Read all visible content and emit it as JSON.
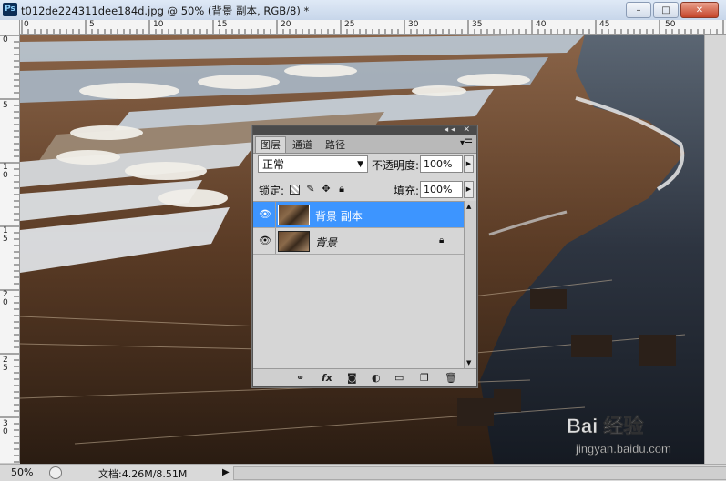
{
  "window": {
    "app_icon": "Ps",
    "title": "t012de224311dee184d.jpg @ 50% (背景 副本, RGB/8) *",
    "minimize_label": "–",
    "maximize_label": "□",
    "close_label": "✕"
  },
  "ruler": {
    "top_labels": [
      "0",
      "5",
      "10",
      "15",
      "20",
      "25",
      "30",
      "35",
      "40",
      "45",
      "50"
    ],
    "left_labels": [
      "0",
      "5",
      "1\n0",
      "1\n5",
      "2\n0",
      "2\n5",
      "3\n0"
    ]
  },
  "status": {
    "zoom": "50%",
    "doc_info": "文档:4.26M/8.51M",
    "arrow": "▶"
  },
  "layers_panel": {
    "tabs": [
      "图层",
      "通道",
      "路径"
    ],
    "menu_icon": "▾☰",
    "collapse_icons": "◂◂ ✕",
    "blend_mode": "正常",
    "blend_caret": "▼",
    "opacity_label": "不透明度:",
    "opacity_value": "100%",
    "stepper_icon": "▶",
    "lock_label": "锁定:",
    "fill_label": "填充:",
    "fill_value": "100%",
    "layers": [
      {
        "name": "背景 副本",
        "selected": true,
        "visible": true,
        "locked": false
      },
      {
        "name": "背景",
        "selected": false,
        "visible": true,
        "locked": true
      }
    ],
    "lock_icons": [
      "lock-transparent-icon",
      "lock-paint-icon",
      "lock-move-icon",
      "lock-all-icon"
    ],
    "bottom_icons": [
      "link-layers-icon",
      "fx-icon",
      "mask-icon",
      "adjustment-icon",
      "group-icon",
      "new-layer-icon",
      "trash-icon"
    ]
  },
  "watermark": {
    "brand": "Bai 经验",
    "url": "jingyan.baidu.com"
  },
  "colors": {
    "selection": "#3d95ff",
    "titlebar": "#c7d6ea",
    "close_button": "#c5452a"
  }
}
